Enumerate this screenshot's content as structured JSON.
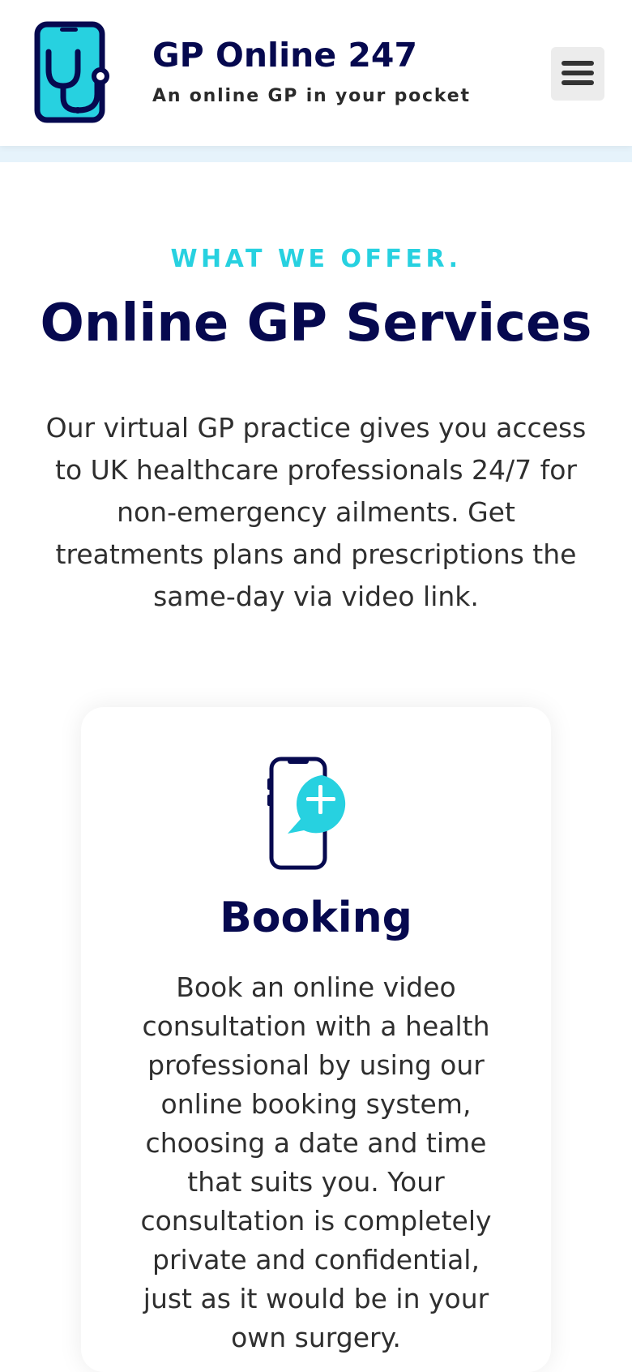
{
  "header": {
    "site_title": "GP Online 247",
    "tagline": "An online GP in your pocket",
    "logo_icon": "phone-stethoscope-icon",
    "menu_icon": "hamburger-menu-icon"
  },
  "services": {
    "eyebrow": "WHAT WE OFFER.",
    "title": "Online GP Services",
    "intro": "Our virtual GP practice gives you access to UK healthcare professionals 24/7 for non-emergency ailments. Get treatments plans and prescriptions the same-day via video link.",
    "cards": [
      {
        "icon": "phone-chat-plus-icon",
        "title": "Booking",
        "text": "Book an online video consultation with a health professional by using our online booking system, choosing a date and time that suits you. Your consultation is completely private and confidential, just as it would be in your own surgery."
      }
    ]
  },
  "colors": {
    "brand_navy": "#06094f",
    "accent_cyan": "#27d1e0",
    "body_text": "#2f2f2f",
    "header_band": "#e6f3fb"
  }
}
